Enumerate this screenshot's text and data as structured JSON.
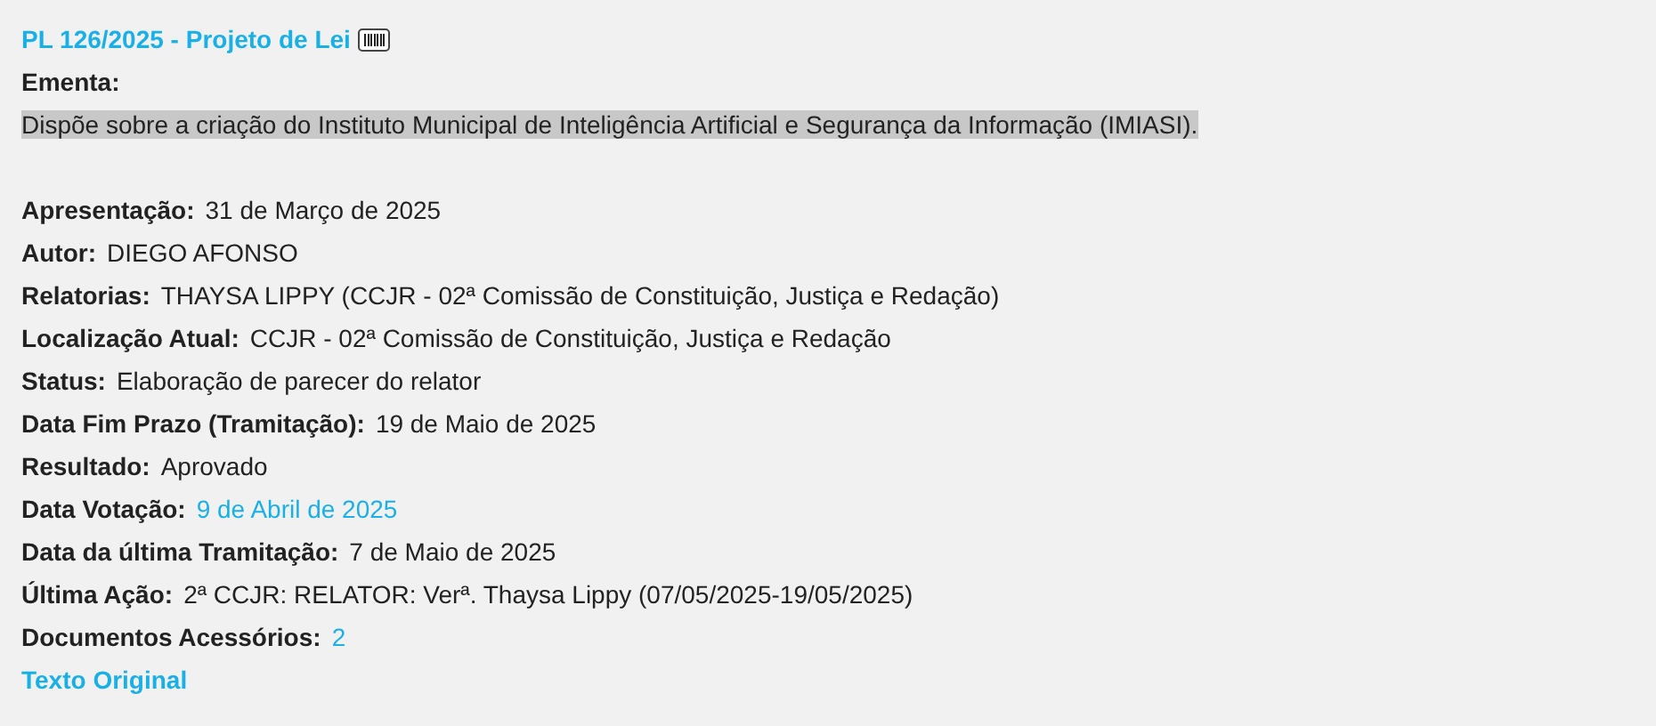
{
  "title": "PL 126/2025 - Projeto de Lei",
  "ementa": {
    "label": "Ementa:",
    "text": "Dispõe sobre a criação do Instituto Municipal de Inteligência Artificial e Segurança da Informação (IMIASI)."
  },
  "fields": [
    {
      "label": "Apresentação:",
      "value": "31 de Março de 2025",
      "kind": "text"
    },
    {
      "label": "Autor:",
      "value": "DIEGO AFONSO",
      "kind": "text"
    },
    {
      "label": "Relatorias:",
      "value": "THAYSA LIPPY (CCJR - 02ª Comissão de Constituição, Justiça e Redação)",
      "kind": "text"
    },
    {
      "label": "Localização Atual:",
      "value": "CCJR - 02ª Comissão de Constituição, Justiça e Redação",
      "kind": "text"
    },
    {
      "label": "Status:",
      "value": "Elaboração de parecer do relator",
      "kind": "text"
    },
    {
      "label": "Data Fim Prazo (Tramitação):",
      "value": "19 de Maio de 2025",
      "kind": "text"
    },
    {
      "label": "Resultado:",
      "value": "Aprovado",
      "kind": "text"
    },
    {
      "label": "Data Votação:",
      "value": "9 de Abril de 2025",
      "kind": "link"
    },
    {
      "label": "Data da última Tramitação:",
      "value": "7 de Maio de 2025",
      "kind": "text"
    },
    {
      "label": "Última Ação:",
      "value": "2ª CCJR: RELATOR: Verª. Thaysa Lippy (07/05/2025-19/05/2025)",
      "kind": "text"
    },
    {
      "label": "Documentos Acessórios:",
      "value": "2",
      "kind": "link"
    }
  ],
  "footer_link": "Texto Original"
}
